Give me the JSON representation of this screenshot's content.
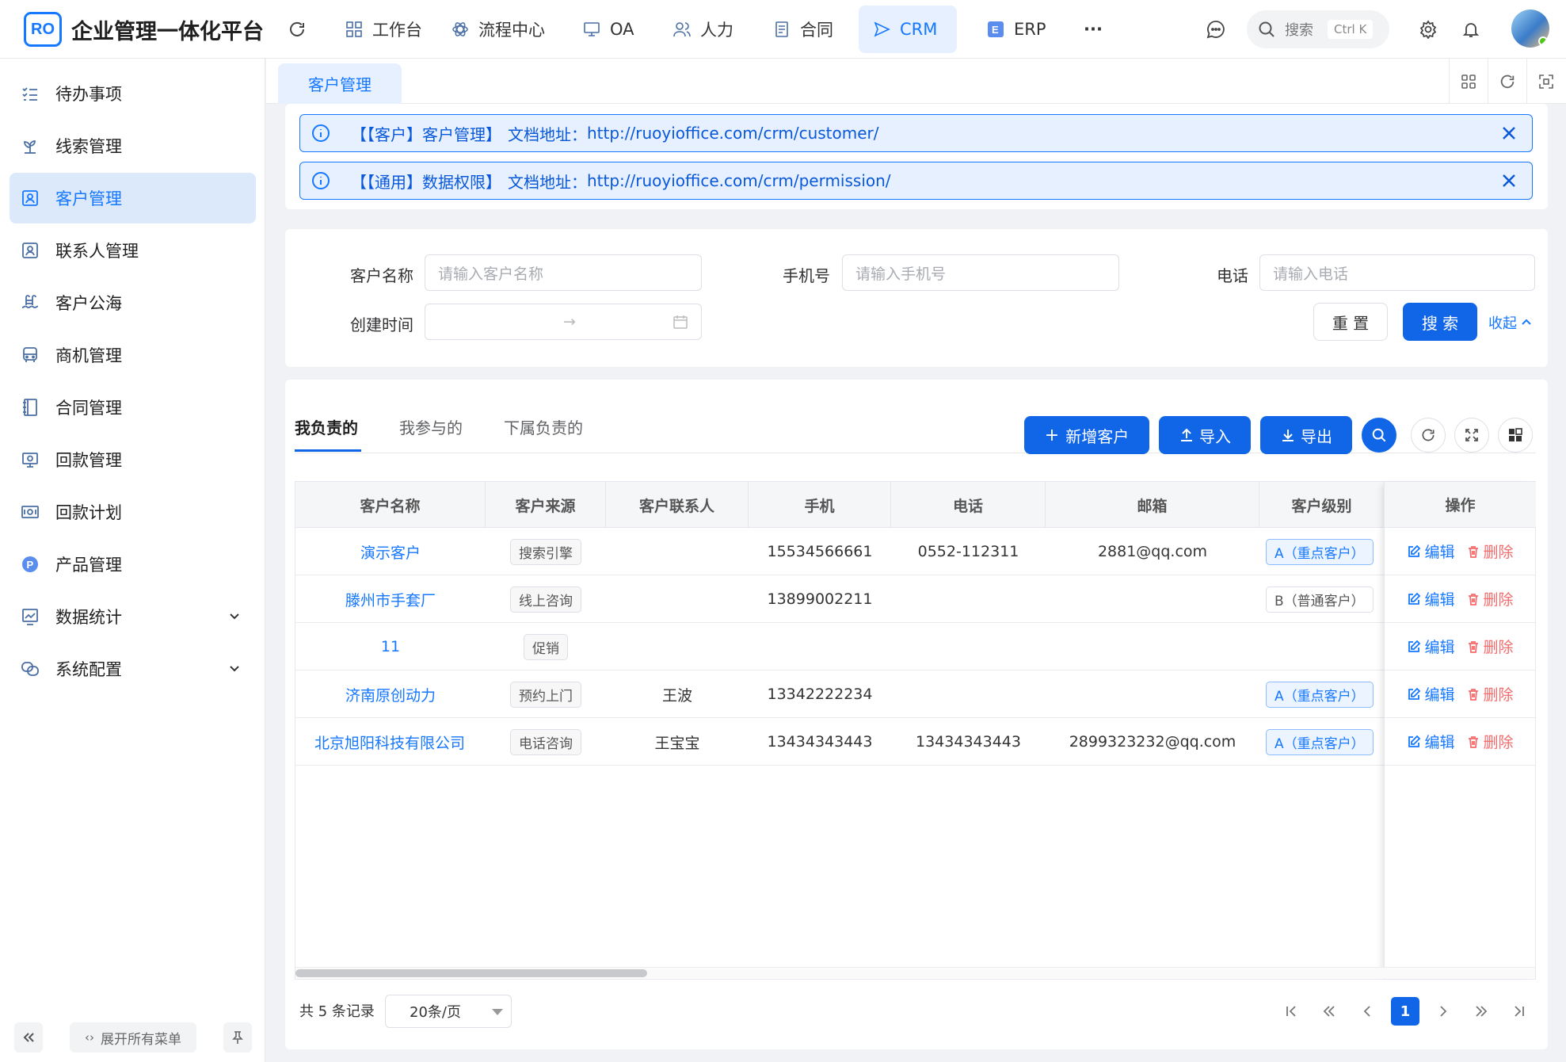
{
  "header": {
    "logo_text": "RO",
    "app_title": "企业管理一体化平台",
    "menus": [
      {
        "label": "工作台",
        "icon": "grid-icon"
      },
      {
        "label": "流程中心",
        "icon": "atom-icon"
      },
      {
        "label": "OA",
        "icon": "monitor-icon"
      },
      {
        "label": "人力",
        "icon": "users-icon"
      },
      {
        "label": "合同",
        "icon": "doc-icon"
      },
      {
        "label": "CRM",
        "icon": "send-icon"
      },
      {
        "label": "ERP",
        "icon": "erp-icon"
      }
    ],
    "more": "···",
    "search_placeholder": "搜索",
    "search_shortcut": "Ctrl K"
  },
  "sidebar": {
    "items": [
      {
        "label": "待办事项",
        "icon": "todo-list-icon"
      },
      {
        "label": "线索管理",
        "icon": "leaf-icon"
      },
      {
        "label": "客户管理",
        "icon": "customer-card-icon"
      },
      {
        "label": "联系人管理",
        "icon": "contact-card-icon"
      },
      {
        "label": "客户公海",
        "icon": "pool-icon"
      },
      {
        "label": "商机管理",
        "icon": "bus-icon"
      },
      {
        "label": "合同管理",
        "icon": "notebook-icon"
      },
      {
        "label": "回款管理",
        "icon": "payment-icon"
      },
      {
        "label": "回款计划",
        "icon": "plan-icon"
      },
      {
        "label": "产品管理",
        "icon": "product-icon"
      },
      {
        "label": "数据统计",
        "icon": "chart-icon"
      },
      {
        "label": "系统配置",
        "icon": "config-icon"
      }
    ],
    "active_index": 2,
    "expand_all": "展开所有菜单"
  },
  "tabs": {
    "current": "客户管理"
  },
  "alerts": [
    {
      "tag": "【【客户】客户管理】",
      "text": "文档地址：",
      "url": "http://ruoyioffice.com/crm/customer/"
    },
    {
      "tag": "【【通用】数据权限】",
      "text": "文档地址：",
      "url": "http://ruoyioffice.com/crm/permission/"
    }
  ],
  "filters": {
    "name_label": "客户名称",
    "name_placeholder": "请输入客户名称",
    "mobile_label": "手机号",
    "mobile_placeholder": "请输入手机号",
    "phone_label": "电话",
    "phone_placeholder": "请输入电话",
    "created_label": "创建时间",
    "range_sep": "→",
    "reset": "重 置",
    "search": "搜 索",
    "collapse": "收起"
  },
  "content_tabs": [
    "我负责的",
    "我参与的",
    "下属负责的"
  ],
  "toolbar": {
    "add": "新增客户",
    "import": "导入",
    "export": "导出"
  },
  "table": {
    "columns": [
      "客户名称",
      "客户来源",
      "客户联系人",
      "手机",
      "电话",
      "邮箱",
      "客户级别",
      "操作"
    ],
    "rows": [
      {
        "name": "演示客户",
        "source": "搜索引擎",
        "contact": "",
        "mobile": "15534566661",
        "phone": "0552-112311",
        "email": "2881@qq.com",
        "level": "A（重点客户）"
      },
      {
        "name": "滕州市手套厂",
        "source": "线上咨询",
        "contact": "",
        "mobile": "13899002211",
        "phone": "",
        "email": "",
        "level": "B（普通客户）"
      },
      {
        "name": "11",
        "source": "促销",
        "contact": "",
        "mobile": "",
        "phone": "",
        "email": "",
        "level": ""
      },
      {
        "name": "济南原创动力",
        "source": "预约上门",
        "contact": "王波",
        "mobile": "13342222234",
        "phone": "",
        "email": "",
        "level": "A（重点客户）"
      },
      {
        "name": "北京旭阳科技有限公司",
        "source": "电话咨询",
        "contact": "王宝宝",
        "mobile": "13434343443",
        "phone": "13434343443",
        "email": "2899323232@qq.com",
        "level": "A（重点客户）"
      }
    ],
    "edit": "编辑",
    "delete": "删除"
  },
  "pagination": {
    "total": "共 5 条记录",
    "page_size": "20条/页",
    "current_page": "1"
  },
  "colors": {
    "primary": "#1677ff",
    "danger": "#f56c6c"
  }
}
